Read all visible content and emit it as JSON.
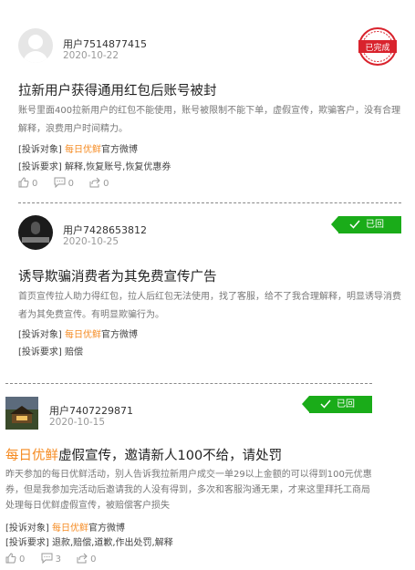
{
  "brand_color": "#f58a20",
  "posts": [
    {
      "username": "用户7514877415",
      "date": "2020-10-22",
      "status": "已完成",
      "title": "拉新用户获得通用红包后账号被封",
      "description": "账号里面400拉新用户的红包不能使用，账号被限制不能下单，虚假宣传，欺骗客户，没有合理解释，浪费用户时间精力。",
      "target_label": "[投诉对象]",
      "target_brand": "每日优鲜",
      "target_rest": "官方微博",
      "request_label": "[投诉要求]",
      "request_text": "解释,恢复账号,恢复优惠券",
      "likes": "0",
      "comments": "0",
      "shares": "0"
    },
    {
      "username": "用户7428653812",
      "date": "2020-10-25",
      "status": "已回复",
      "title": "诱导欺骗消费者为其免费宣传广告",
      "description": "首页宣传拉人助力得红包，拉人后红包无法使用，找了客服，给不了我合理解释，明显诱导消费者为其免费宣传。有明显欺骗行为。",
      "target_label": "[投诉对象]",
      "target_brand": "每日优鲜",
      "target_rest": "官方微博",
      "request_label": "[投诉要求]",
      "request_text": "赔偿"
    },
    {
      "username": "用户7407229871",
      "date": "2020-10-15",
      "status": "已回复",
      "title_brand": "每日优鲜",
      "title_rest": "虚假宣传，邀请新人100不给，请处罚",
      "description": "昨天参加的每日优鲜活动，别人告诉我拉新用户成交一单29以上金额的可以得到100元优惠券，但是我参加完活动后邀请我的人没有得到，多次和客服沟通无果，才来这里拜托工商局处理每日优鲜虚假宣传，被赔偿客户损失",
      "target_label": "[投诉对象]",
      "target_brand": "每日优鲜",
      "target_rest": "官方微博",
      "request_label": "[投诉要求]",
      "request_text": "退款,赔偿,道歉,作出处罚,解释",
      "likes": "0",
      "comments": "3",
      "shares": "0"
    }
  ]
}
